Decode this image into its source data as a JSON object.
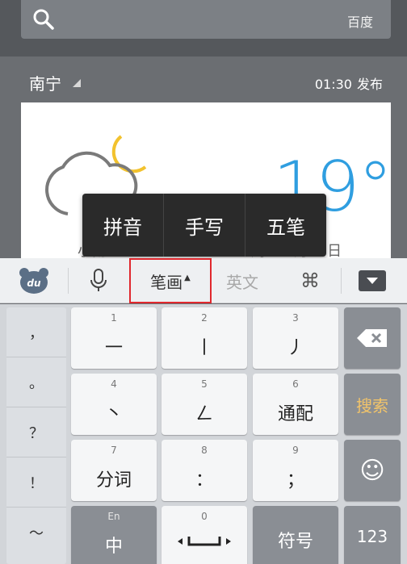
{
  "search": {
    "brand": "百度"
  },
  "weather": {
    "city": "南宁",
    "publish_time": "01:30",
    "publish_label": "发布",
    "temperature": "19°",
    "condition": "小雨",
    "date": "周三 3月19日"
  },
  "popup": {
    "items": [
      "拼音",
      "手写",
      "五笔"
    ]
  },
  "toolbar": {
    "logo": "du",
    "stroke_label": "笔画",
    "caret": "▲",
    "english_label": "英文",
    "cmd_symbol": "⌘"
  },
  "keyboard": {
    "symbols": [
      "，",
      "。",
      "？",
      "！",
      "～"
    ],
    "keys": [
      {
        "num": "1",
        "main": "一"
      },
      {
        "num": "2",
        "main": "丨"
      },
      {
        "num": "3",
        "main": "丿"
      },
      {
        "num": "4",
        "main": "丶"
      },
      {
        "num": "5",
        "main": "ㄥ"
      },
      {
        "num": "6",
        "main": "通配"
      },
      {
        "num": "7",
        "main": "分词"
      },
      {
        "num": "8",
        "main": "："
      },
      {
        "num": "9",
        "main": "；"
      },
      {
        "num": "En",
        "main": "中"
      },
      {
        "num": "0",
        "main": ""
      },
      {
        "num": "",
        "main": "符号"
      }
    ],
    "search_label": "搜索",
    "numbers_label": "123",
    "emoji_symbol": "☺"
  }
}
